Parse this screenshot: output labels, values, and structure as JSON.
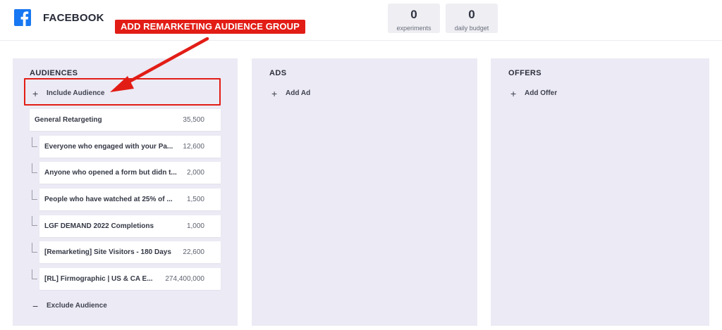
{
  "header": {
    "title": "FACEBOOK",
    "stats": [
      {
        "value": "0",
        "label": "experiments"
      },
      {
        "value": "0",
        "label": "daily budget"
      }
    ]
  },
  "callout": {
    "text": "ADD REMARKETING AUDIENCE GROUP",
    "color": "#e21d16"
  },
  "audiences": {
    "title": "AUDIENCES",
    "include_label": "Include Audience",
    "exclude_label": "Exclude Audience",
    "parent": {
      "name": "General Retargeting",
      "size": "35,500"
    },
    "children": [
      {
        "name": "Everyone who engaged with your Pa...",
        "size": "12,600"
      },
      {
        "name": "Anyone who opened a form but didn t...",
        "size": "2,000"
      },
      {
        "name": "People who have watched at 25% of ...",
        "size": "1,500"
      },
      {
        "name": "LGF DEMAND 2022 Completions",
        "size": "1,000"
      },
      {
        "name": "[Remarketing] Site Visitors - 180 Days",
        "size": "22,600"
      },
      {
        "name": "[RL] Firmographic | US & CA E...",
        "size": "274,400,000"
      }
    ]
  },
  "ads": {
    "title": "ADS",
    "add_label": "Add Ad"
  },
  "offers": {
    "title": "OFFERS",
    "add_label": "Add Offer"
  },
  "icons": {
    "brand": "facebook-icon",
    "add": "plus-icon",
    "remove": "minus-icon"
  },
  "colors": {
    "facebook_blue": "#1877f2",
    "column_bg": "#eceaf4",
    "annotation_red": "#e21d16"
  }
}
